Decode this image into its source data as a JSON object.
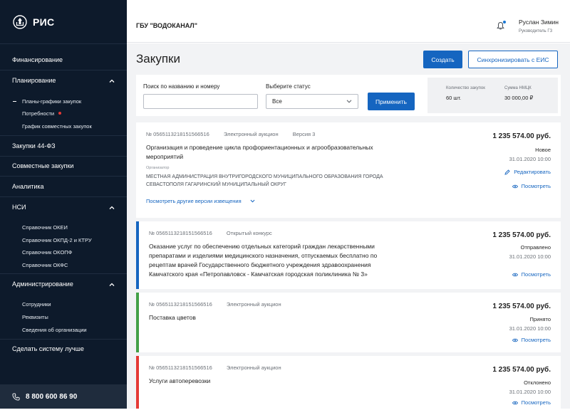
{
  "sidebar": {
    "logo_text": "РИС",
    "items": [
      {
        "label": "Финансирование"
      },
      {
        "label": "Планирование"
      },
      {
        "label": "Закупки 44-ФЗ"
      },
      {
        "label": "Совместные закупки"
      },
      {
        "label": "Аналитика"
      },
      {
        "label": "НСИ"
      },
      {
        "label": "Администрирование"
      },
      {
        "label": "Сделать систему лучше"
      }
    ],
    "planning_sub": [
      "Планы-графики закупок",
      "Потребности",
      "График совместных закупок"
    ],
    "nsi_sub": [
      "Справочник ОКЕИ",
      "Справочник ОКПД-2 и КТРУ",
      "Справочник ОКОПФ",
      "Справочник ОКФС"
    ],
    "admin_sub": [
      "Сотрудники",
      "Реквизиты",
      "Сведения об организации"
    ],
    "phone": "8 800 600 86 90"
  },
  "header": {
    "org": "ГБУ \"ВОДОКАНАЛ\"",
    "user_name": "Руслан Зимин",
    "user_role": "Руководитель ГЗ"
  },
  "page": {
    "title": "Закупки",
    "create_label": "Создать",
    "sync_label": "Синхронизировать с ЕИС"
  },
  "filter": {
    "search_label": "Поиск по названию и номеру",
    "search_value": "",
    "status_label": "Выберите статус",
    "status_value": "Все",
    "apply_label": "Применить",
    "count_label": "Количество закупок",
    "count_value": "60 шт.",
    "sum_label": "Сумма НМЦК",
    "sum_value": "30 000,00 ₽"
  },
  "cards": [
    {
      "number": "№ 0565113218151566516",
      "method": "Электронный аукцион",
      "version": "Версия 3",
      "title": "Организация и проведение цикла профориентационных и агрообразовательных мероприятий",
      "org_label": "Организатор",
      "org_name": "МЕСТНАЯ АДМИНИСТРАЦИЯ ВНУТРИГОРОДСКОГО МУНИЦИПАЛЬНОГО ОБРАЗОВАНИЯ ГОРОДА СЕВАСТОПОЛЯ ГАГАРИНСКИЙ МУНИЦИПАЛЬНЫЙ ОКРУГ",
      "versions_link": "Посмотреть другие версии извещения",
      "price": "1 235 574.00 руб.",
      "status": "Новое",
      "date": "31.01.2020 10:00",
      "edit_label": "Редактировать",
      "view_label": "Посмотреть"
    },
    {
      "number": "№ 0565113218151566516",
      "method": "Открытый конкурс",
      "title": "Оказание услуг по обеспечению отдельных категорий граждан лекарственными препаратами и изделиями медицинского назначения, отпускаемых бесплатно по рецептам врачей Государственного бюджетного учреждения здравоохранения Камчатского края «Петропавловск - Камчатская городская поликлиника № 3»",
      "price": "1 235 574.00 руб.",
      "status": "Отправлено",
      "date": "31.01.2020 10:00",
      "view_label": "Посмотреть"
    },
    {
      "number": "№ 0565113218151566516",
      "method": "Электронный аукцион",
      "title": "Поставка цветов",
      "price": "1 235 574.00 руб.",
      "status": "Принято",
      "date": "31.01.2020 10:00",
      "view_label": "Посмотреть"
    },
    {
      "number": "№ 0565113218151566516",
      "method": "Электронный аукцион",
      "title": "Услуги автоперевозки",
      "price": "1 235 574.00 руб.",
      "status": "Отклонено",
      "date": "31.01.2020 10:00",
      "view_label": "Посмотреть"
    }
  ],
  "colors": {
    "sidebar_bg": "#0d1a2b",
    "primary": "#1565c0",
    "status_sent": "#1565c0",
    "status_accepted": "#43a047",
    "status_rejected": "#e53935",
    "notification_dot": "#e53935"
  },
  "icons": [
    "emblem-icon",
    "chevron-up-icon",
    "chevron-down-icon",
    "phone-icon",
    "bell-icon",
    "pencil-icon",
    "eye-icon"
  ]
}
